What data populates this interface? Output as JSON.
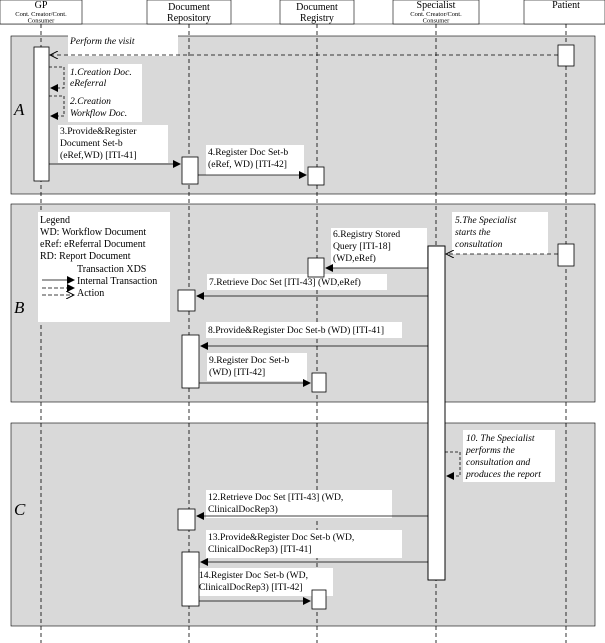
{
  "actors": [
    {
      "name": "GP",
      "sub": [
        "Cont. Creator/Cont.",
        "Consumer"
      ]
    },
    {
      "name": "Document",
      "name2": "Repository"
    },
    {
      "name": "Document",
      "name2": "Registry"
    },
    {
      "name": "Specialist",
      "sub": [
        "Cont. Creator/Cont.",
        "Consumer"
      ]
    },
    {
      "name": "Patient"
    }
  ],
  "sections": [
    "A",
    "B",
    "C"
  ],
  "messages": {
    "perform_visit": "Perform the visit",
    "m1a": "1.Creation Doc.",
    "m1b": "eReferral",
    "m2a": "2.Creation",
    "m2b": "Workflow Doc.",
    "m3a": "3.Provide&Register",
    "m3b": "Document Set-b",
    "m3c": "(eRef,WD) [ITI-41]",
    "m4a": "4.Register Doc Set-b",
    "m4b": "(eRef, WD) [ITI-42]",
    "m5a": "5.The Specialist",
    "m5b": "starts the",
    "m5c": "consultation",
    "m6a": "6.Registry Stored",
    "m6b": "Query [ITI-18]",
    "m6c": "(WD,eRef)",
    "m7": "7.Retrieve Doc Set [ITI-43] (WD,eRef)",
    "m8": "8.Provide&Register Doc Set-b (WD) [ITI-41]",
    "m9a": "9.Register Doc Set-b",
    "m9b": "(WD) [ITI-42]",
    "m10a": "10. The Specialist",
    "m10b": "performs the",
    "m10c": "consultation and",
    "m10d": "produces the report",
    "m12a": "12.Retrieve Doc Set [ITI-43] (WD,",
    "m12b": "ClinicalDocRep3)",
    "m13a": "13.Provide&Register Doc Set-b (WD,",
    "m13b": "ClinicalDocRep3) [ITI-41]",
    "m14a": "14.Register Doc Set-b (WD,",
    "m14b": "ClinicalDocRep3) [ITI-42]"
  },
  "legend": {
    "title": "Legend",
    "wd": "WD: Workflow Document",
    "eref": "eRef: eReferral Document",
    "rd": "RD: Report Document",
    "xds": "Transaction XDS",
    "internal": "Internal Transaction",
    "action": "Action"
  }
}
